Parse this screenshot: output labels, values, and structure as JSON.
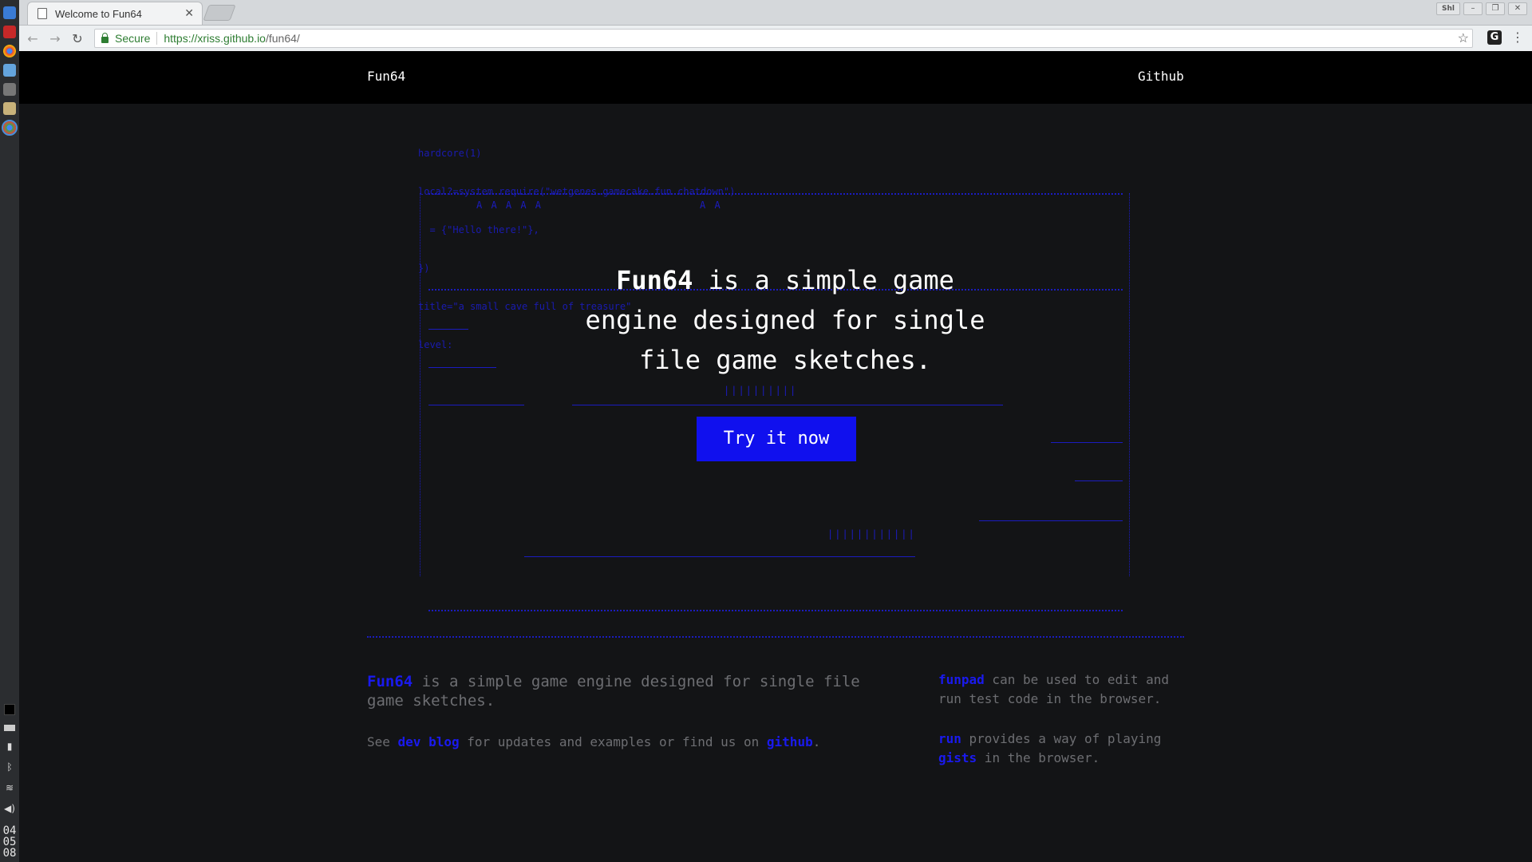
{
  "browser": {
    "tab_title": "Welcome to Fun64",
    "secure_label": "Secure",
    "url_scheme_host": "https://xriss.github.io",
    "url_path": "/fun64/",
    "ext_label": "G",
    "ext_tray_label": "Shl"
  },
  "nav": {
    "brand": "Fun64",
    "github": "Github"
  },
  "bg_code": {
    "lines": [
      "hardcore(1)",
      "local?=system.require(\"wetgenes.gamecake.fun.chatdown\")",
      "  = {\"Hello there!\"},",
      "})",
      "title=\"a small cave full of treasure\"",
      "level:"
    ]
  },
  "hero": {
    "strong": "Fun64",
    "line1_rest": " is a simple game",
    "line2": "engine designed for single",
    "line3": "file game sketches.",
    "cta": "Try it now"
  },
  "footer": {
    "intro_link": "Fun64",
    "intro_rest": " is a simple game engine designed for single file game sketches.",
    "see": "See ",
    "dev_blog": "dev blog",
    "mid": " for updates and examples or find us on ",
    "github": "github",
    "end": ".",
    "funpad": "funpad",
    "funpad_rest": " can be used to edit and run test code in the browser.",
    "run": "run",
    "run_mid": " provides a way of playing ",
    "gists": "gists",
    "run_end": " in the browser."
  },
  "system": {
    "clock": [
      "04",
      "05",
      "08"
    ]
  }
}
